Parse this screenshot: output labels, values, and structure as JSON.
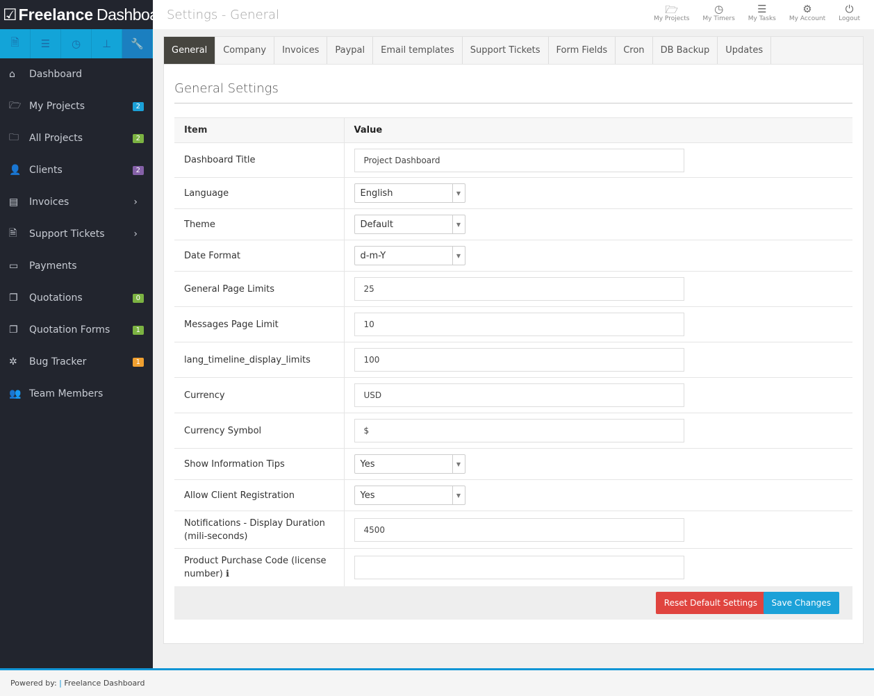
{
  "app": {
    "logo_bold": "Freelance",
    "logo_light": "Dashboard",
    "page_title": "Settings - General"
  },
  "topnav": [
    {
      "label": "My Projects",
      "icon": "folder-open-icon",
      "g": "🗁"
    },
    {
      "label": "My Timers",
      "icon": "clock-icon",
      "g": "◷"
    },
    {
      "label": "My Tasks",
      "icon": "list-icon",
      "g": "☰"
    },
    {
      "label": "My Account",
      "icon": "gears-icon",
      "g": "⚙"
    },
    {
      "label": "Logout",
      "icon": "power-icon",
      "g": "⏻"
    }
  ],
  "sidebar": {
    "items": [
      {
        "label": "Dashboard",
        "icon": "home-icon",
        "g": "⌂"
      },
      {
        "label": "My Projects",
        "icon": "folder-open-icon",
        "g": "🗁",
        "badge": "2",
        "color": "#1ba1d8"
      },
      {
        "label": "All Projects",
        "icon": "folder-icon",
        "g": "🗀",
        "badge": "2",
        "color": "#7cb342"
      },
      {
        "label": "Clients",
        "icon": "user-icon",
        "g": "👤",
        "badge": "2",
        "color": "#8561a8"
      },
      {
        "label": "Invoices",
        "icon": "list-alt-icon",
        "g": "▤",
        "chevron": true
      },
      {
        "label": "Support Tickets",
        "icon": "file-icon",
        "g": "🗎",
        "chevron": true
      },
      {
        "label": "Payments",
        "icon": "credit-card-icon",
        "g": "▭"
      },
      {
        "label": "Quotations",
        "icon": "copy-icon",
        "g": "❐",
        "badge": "0",
        "color": "#7cb342"
      },
      {
        "label": "Quotation Forms",
        "icon": "copy-icon",
        "g": "❐",
        "badge": "1",
        "color": "#7cb342"
      },
      {
        "label": "Bug Tracker",
        "icon": "bug-icon",
        "g": "✲",
        "badge": "1",
        "color": "#f0a030"
      },
      {
        "label": "Team Members",
        "icon": "users-icon",
        "g": "👥"
      }
    ]
  },
  "tabs": [
    "General",
    "Company",
    "Invoices",
    "Paypal",
    "Email templates",
    "Support Tickets",
    "Form Fields",
    "Cron",
    "DB Backup",
    "Updates"
  ],
  "section_title": "General Settings",
  "table": {
    "headers": [
      "Item",
      "Value"
    ],
    "rows": [
      {
        "label": "Dashboard Title",
        "type": "input",
        "value": "Project Dashboard"
      },
      {
        "label": "Language",
        "type": "select",
        "value": "English"
      },
      {
        "label": "Theme",
        "type": "select",
        "value": "Default"
      },
      {
        "label": "Date Format",
        "type": "select",
        "value": "d-m-Y"
      },
      {
        "label": "General Page Limits",
        "type": "input",
        "value": "25"
      },
      {
        "label": "Messages Page Limit",
        "type": "input",
        "value": "10"
      },
      {
        "label": "lang_timeline_display_limits",
        "type": "input",
        "value": "100"
      },
      {
        "label": "Currency",
        "type": "input",
        "value": "USD"
      },
      {
        "label": "Currency Symbol",
        "type": "input",
        "value": "$"
      },
      {
        "label": "Show Information Tips",
        "type": "select",
        "value": "Yes"
      },
      {
        "label": "Allow Client Registration",
        "type": "select",
        "value": "Yes"
      },
      {
        "label": "Notifications - Display Duration (mili-seconds)",
        "type": "input",
        "value": "4500"
      },
      {
        "label": "Product Purchase Code (license number)",
        "type": "input",
        "value": "",
        "info": true
      }
    ]
  },
  "buttons": {
    "reset": "Reset Default Settings",
    "save": "Save Changes",
    "reset_color": "#e0443f",
    "save_color": "#1ba1d8"
  },
  "footer": {
    "powered": "Powered by:",
    "sep": "|",
    "name": "Freelance Dashboard"
  }
}
